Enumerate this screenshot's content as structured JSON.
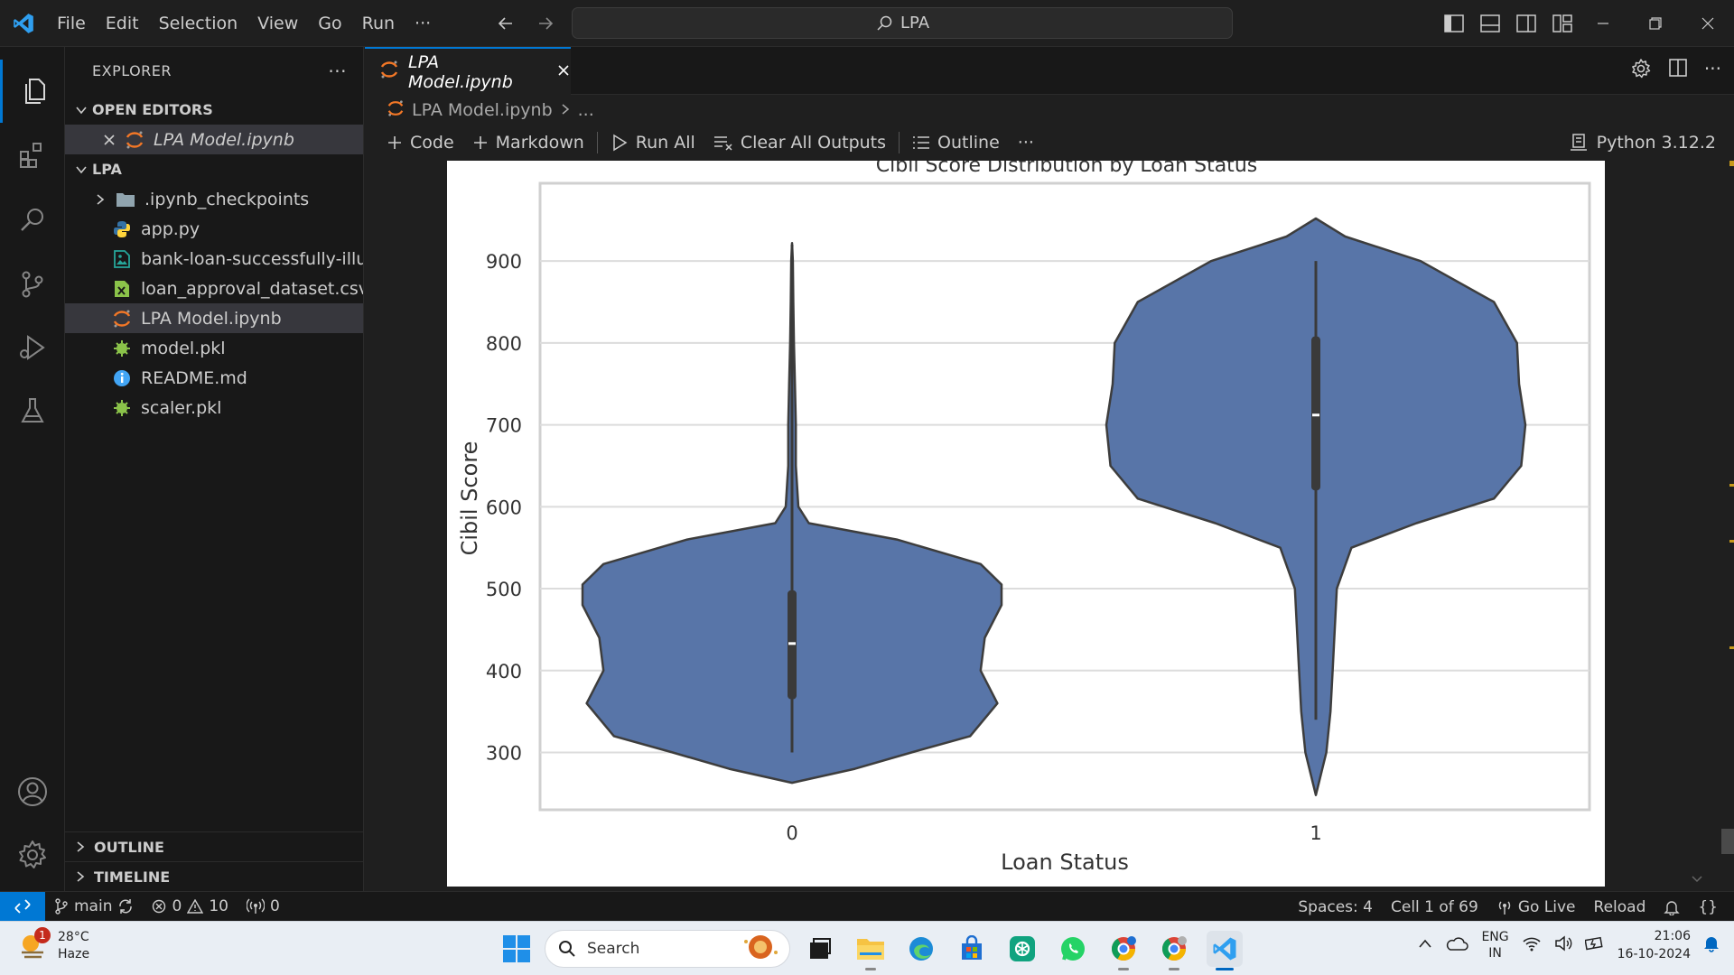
{
  "titlebar": {
    "menu": [
      "File",
      "Edit",
      "Selection",
      "View",
      "Go",
      "Run",
      "···"
    ],
    "search_text": "LPA"
  },
  "sidebar": {
    "title": "EXPLORER",
    "more": "···",
    "open_editors_label": "OPEN EDITORS",
    "open_editors": [
      {
        "name": "LPA Model.ipynb"
      }
    ],
    "folder_label": "LPA",
    "files": [
      {
        "name": ".ipynb_checkpoints",
        "icon": "folder-icon"
      },
      {
        "name": "app.py",
        "icon": "python-icon"
      },
      {
        "name": "bank-loan-successfully-illu...",
        "icon": "image-file-icon"
      },
      {
        "name": "loan_approval_dataset.csv",
        "icon": "csv-icon"
      },
      {
        "name": "LPA Model.ipynb",
        "icon": "jupyter-icon"
      },
      {
        "name": "model.pkl",
        "icon": "pickle-icon"
      },
      {
        "name": "README.md",
        "icon": "info-icon"
      },
      {
        "name": "scaler.pkl",
        "icon": "pickle-icon"
      }
    ],
    "outline_label": "OUTLINE",
    "timeline_label": "TIMELINE"
  },
  "editor": {
    "tab_label": "LPA Model.ipynb",
    "breadcrumb_file": "LPA Model.ipynb",
    "breadcrumb_more": "...",
    "toolbar": {
      "code": "Code",
      "markdown": "Markdown",
      "run_all": "Run All",
      "clear_outputs": "Clear All Outputs",
      "outline": "Outline",
      "more": "···",
      "kernel": "Python 3.12.2"
    }
  },
  "chart_data": {
    "type": "violin",
    "title": "Cibil Score Distribution by Loan Status",
    "xlabel": "Loan Status",
    "ylabel": "Cibil Score",
    "categories": [
      "0",
      "1"
    ],
    "yticks": [
      300,
      400,
      500,
      600,
      700,
      800,
      900
    ],
    "ylim": [
      230,
      995
    ],
    "color": "#5875a8",
    "grid": true,
    "series": [
      {
        "category": "0",
        "min": 300,
        "q1": 365,
        "median": 433,
        "q3": 498,
        "max": 920,
        "profile": [
          [
            263,
            0
          ],
          [
            280,
            0.3
          ],
          [
            300,
            0.57
          ],
          [
            320,
            0.85
          ],
          [
            360,
            0.98
          ],
          [
            400,
            0.9
          ],
          [
            440,
            0.92
          ],
          [
            480,
            1.0
          ],
          [
            505,
            1.0
          ],
          [
            530,
            0.9
          ],
          [
            560,
            0.5
          ],
          [
            580,
            0.08
          ],
          [
            600,
            0.03
          ],
          [
            650,
            0.018
          ],
          [
            700,
            0.018
          ],
          [
            750,
            0.014
          ],
          [
            800,
            0.009
          ],
          [
            850,
            0.006
          ],
          [
            900,
            0.004
          ],
          [
            922,
            0
          ]
        ]
      },
      {
        "category": "1",
        "min": 340,
        "q1": 620,
        "median": 712,
        "q3": 808,
        "max": 900,
        "profile": [
          [
            248,
            0
          ],
          [
            300,
            0.05
          ],
          [
            350,
            0.07
          ],
          [
            400,
            0.08
          ],
          [
            450,
            0.09
          ],
          [
            500,
            0.1
          ],
          [
            550,
            0.17
          ],
          [
            580,
            0.48
          ],
          [
            610,
            0.85
          ],
          [
            650,
            0.98
          ],
          [
            700,
            1.0
          ],
          [
            750,
            0.97
          ],
          [
            800,
            0.96
          ],
          [
            850,
            0.85
          ],
          [
            900,
            0.5
          ],
          [
            930,
            0.14
          ],
          [
            952,
            0
          ]
        ]
      }
    ]
  },
  "statusbar": {
    "branch": "main",
    "errors": "0",
    "warnings": "10",
    "ports": "0",
    "spaces": "Spaces: 4",
    "cell": "Cell 1 of 69",
    "go_live": "Go Live",
    "reload": "Reload"
  },
  "taskbar": {
    "weather_temp": "28°C",
    "weather_desc": "Haze",
    "weather_badge": "1",
    "search_label": "Search",
    "lang_top": "ENG",
    "lang_bottom": "IN",
    "time": "21:06",
    "date": "16-10-2024"
  }
}
